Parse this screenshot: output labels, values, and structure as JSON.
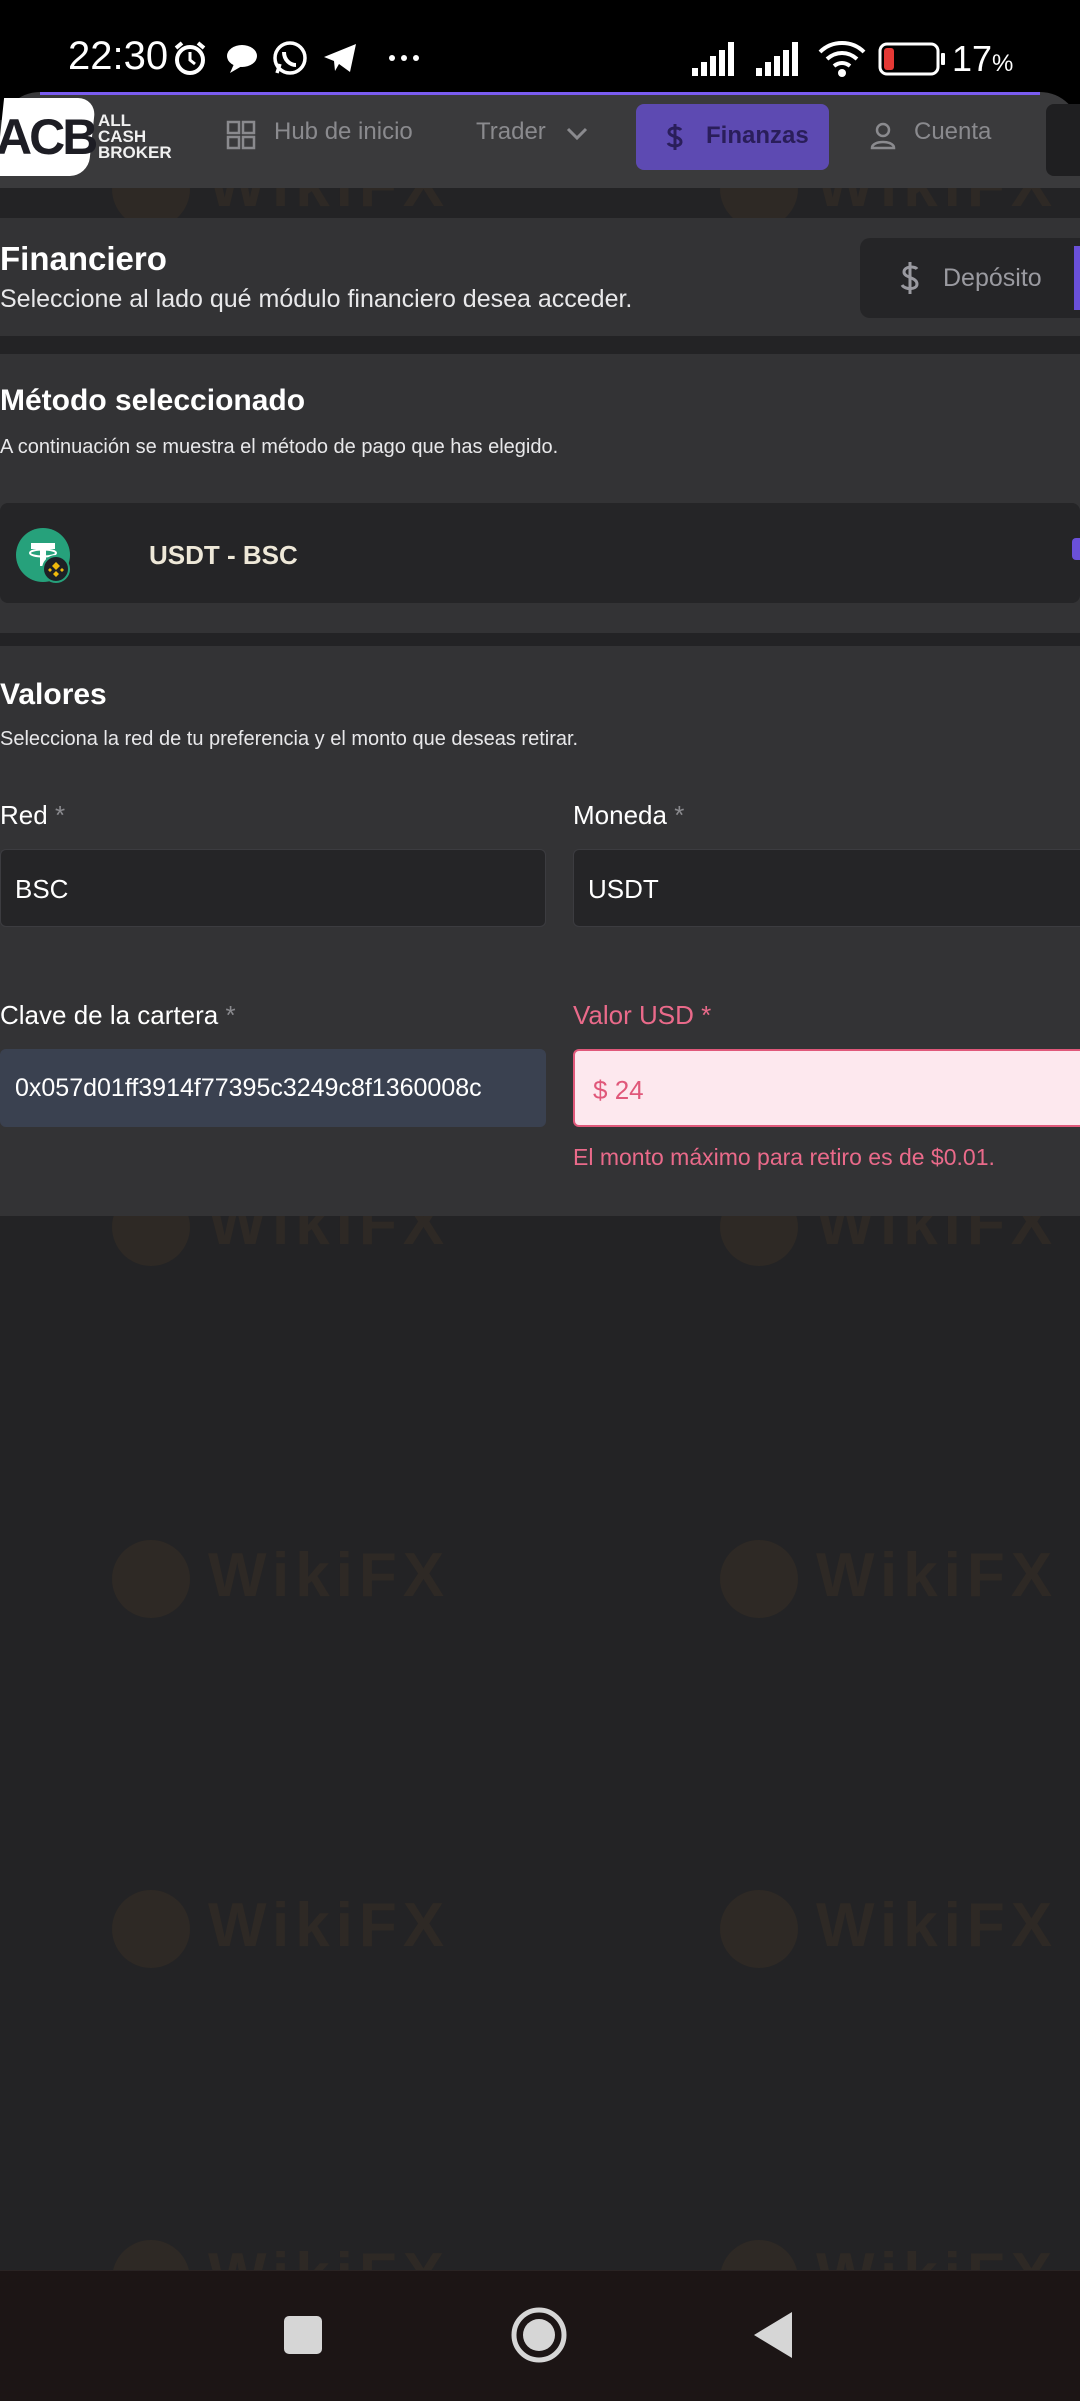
{
  "status_bar": {
    "time": "22:30",
    "battery_percent": "17",
    "battery_unit": "%"
  },
  "logo": {
    "acb": "ACB",
    "line1": "ALL",
    "line2": "CASH",
    "line3": "BROKER"
  },
  "nav": {
    "items": [
      {
        "label": "Hub de inicio",
        "icon": "grid-icon"
      },
      {
        "label": "Trader",
        "icon": "chevron-down-icon"
      },
      {
        "label": "Finanzas",
        "icon": "dollar-icon",
        "active": true
      },
      {
        "label": "Cuenta",
        "icon": "user-icon"
      }
    ]
  },
  "financiero": {
    "title": "Financiero",
    "subtitle": "Seleccione al lado qué módulo financiero desea acceder.",
    "deposit_button": "Depósito"
  },
  "metodo": {
    "title": "Método seleccionado",
    "subtitle": "A continuación se muestra el método de pago que has elegido.",
    "method_name": "USDT - BSC"
  },
  "valores": {
    "title": "Valores",
    "subtitle": "Selecciona la red de tu preferencia y el monto que deseas retirar.",
    "red_label": "Red",
    "red_value": "BSC",
    "moneda_label": "Moneda",
    "moneda_value": "USDT",
    "wallet_label": "Clave de la cartera",
    "wallet_value": "0x057d01ff3914f77395c3249c8f1360008c",
    "usd_label": "Valor USD",
    "usd_prefix": "$",
    "usd_value": "24",
    "usd_error": "El monto máximo para retiro es de $0.01.",
    "required_mark": "*"
  },
  "watermark": {
    "text": "WikiFX"
  },
  "colors": {
    "accent": "#6a50d9",
    "error": "#e0587a",
    "usdt_green": "#26a17b"
  }
}
